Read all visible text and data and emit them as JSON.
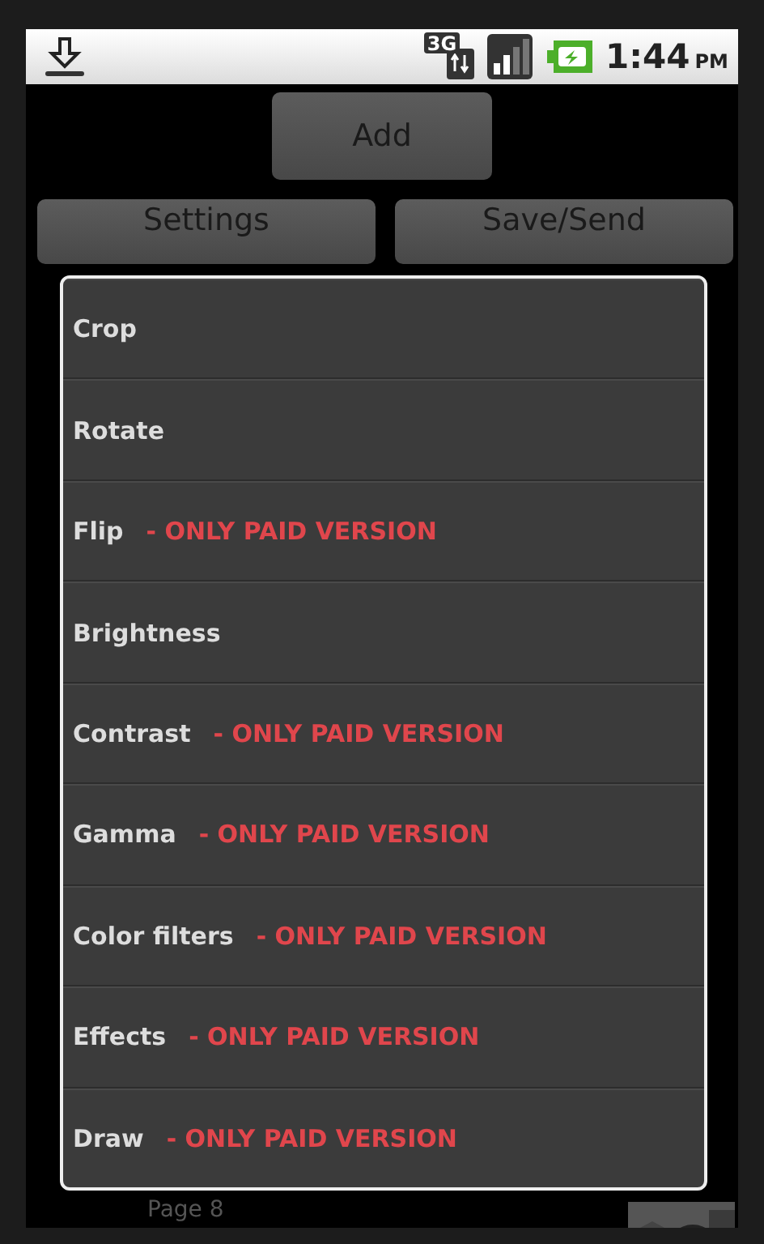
{
  "status_bar": {
    "network": "3G",
    "time": "1:44",
    "period": "PM"
  },
  "buttons": {
    "add": "Add",
    "settings": "Settings",
    "save": "Save/Send"
  },
  "dialog": {
    "items": [
      {
        "label": "Crop"
      },
      {
        "label": "Rotate"
      },
      {
        "label": "Flip",
        "note": "- ONLY PAID VERSION"
      },
      {
        "label": "Brightness"
      },
      {
        "label": "Contrast",
        "note": "- ONLY PAID VERSION"
      },
      {
        "label": "Gamma",
        "note": "- ONLY PAID VERSION"
      },
      {
        "label": "Color filters",
        "note": "- ONLY PAID VERSION"
      },
      {
        "label": "Effects",
        "note": "- ONLY PAID VERSION"
      },
      {
        "label": "Draw",
        "note": "- ONLY PAID VERSION"
      }
    ]
  },
  "pages": [
    {
      "title": "Page 8",
      "kind": "picture"
    }
  ]
}
